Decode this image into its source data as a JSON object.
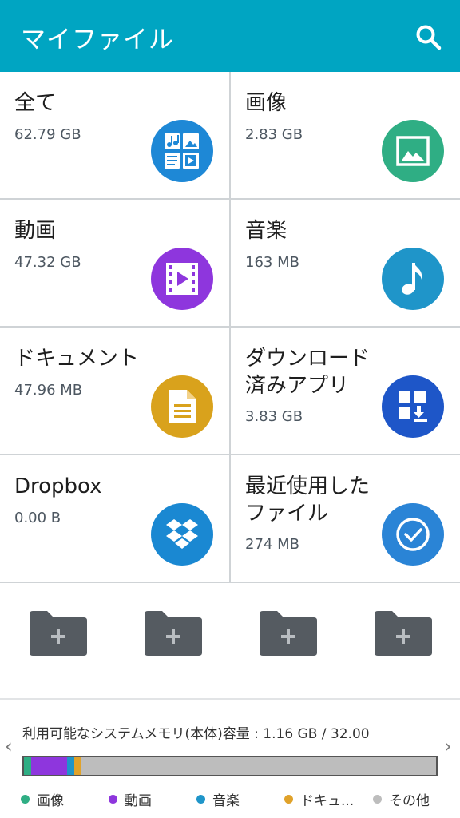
{
  "header": {
    "title": "マイファイル",
    "search_icon": "search-icon"
  },
  "tiles": [
    {
      "label": "全て",
      "size": "62.79 GB",
      "color": "#1e88d6",
      "icon": "all-files-icon"
    },
    {
      "label": "画像",
      "size": "2.83 GB",
      "color": "#2fae84",
      "icon": "image-icon"
    },
    {
      "label": "動画",
      "size": "47.32 GB",
      "color": "#8e36dd",
      "icon": "video-icon"
    },
    {
      "label": "音楽",
      "size": "163 MB",
      "color": "#1f95c9",
      "icon": "music-icon"
    },
    {
      "label": "ドキュメント",
      "size": "47.96 MB",
      "color": "#d9a21c",
      "icon": "document-icon"
    },
    {
      "label1": "ダウンロード",
      "label2": "済みアプリ",
      "size": "3.83 GB",
      "color": "#1e56c8",
      "icon": "download-apps-icon"
    },
    {
      "label": "Dropbox",
      "size": "0.00 B",
      "color": "#1a88d2",
      "icon": "dropbox-icon"
    },
    {
      "label1": "最近使用した",
      "label2": "ファイル",
      "size": "274 MB",
      "color": "#2a84d6",
      "icon": "recent-files-icon"
    }
  ],
  "shortcuts": [
    {
      "icon": "add-folder-icon"
    },
    {
      "icon": "add-folder-icon"
    },
    {
      "icon": "add-folder-icon"
    },
    {
      "icon": "add-folder-icon"
    }
  ],
  "storage": {
    "text": "利用可能なシステムメモリ(本体)容量 : 1.16 GB / 32.00",
    "segments": [
      {
        "name": "画像",
        "color": "#2fae84",
        "fraction": 0.017
      },
      {
        "name": "動画",
        "color": "#8e36dd",
        "fraction": 0.088
      },
      {
        "name": "音楽",
        "color": "#1f95c9",
        "fraction": 0.017
      },
      {
        "name": "ドキュ...",
        "color": "#e0a22a",
        "fraction": 0.017
      },
      {
        "name": "その他",
        "color": "#bdbdbd",
        "fraction": 0.861
      }
    ],
    "legend": [
      "画像",
      "動画",
      "音楽",
      "ドキュ...",
      "その他"
    ],
    "prev_icon": "chevron-left-icon",
    "next_icon": "chevron-right-icon"
  }
}
